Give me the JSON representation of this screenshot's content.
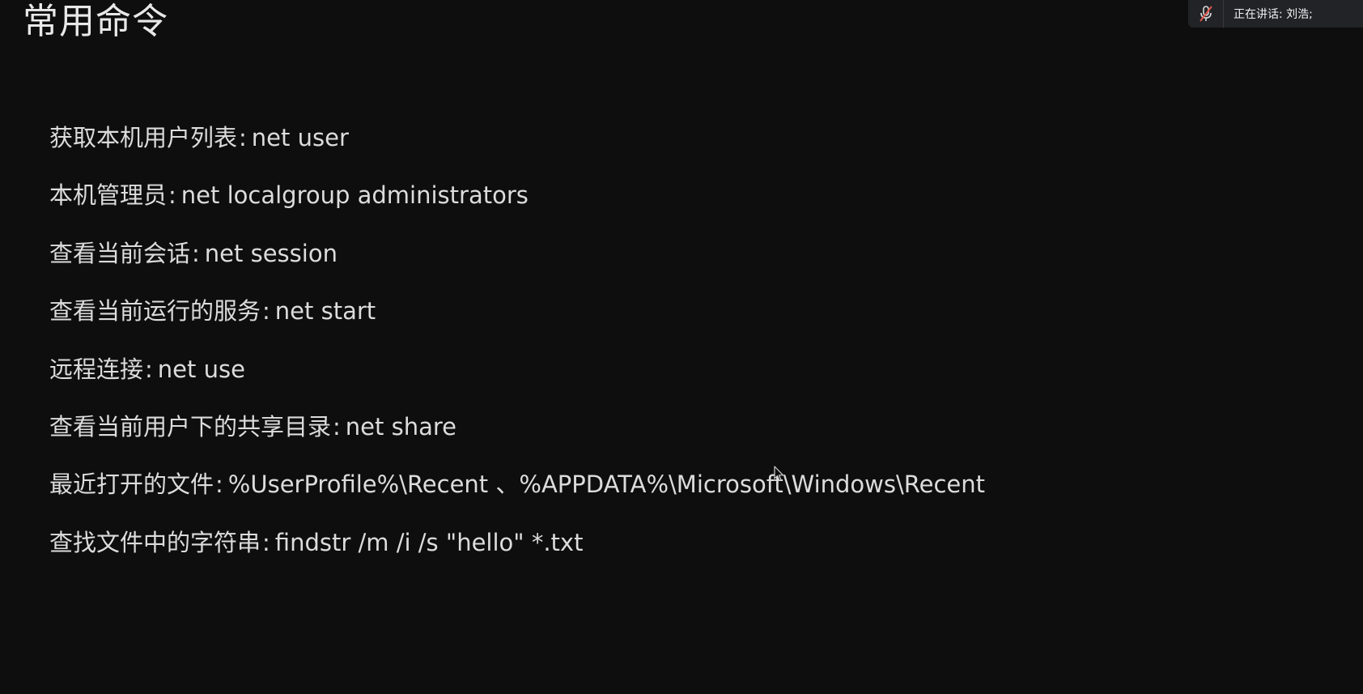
{
  "slide": {
    "title": "常用命令"
  },
  "commands": [
    {
      "label": "获取本机用户列表",
      "command": "net user"
    },
    {
      "label": "本机管理员",
      "command": "net localgroup administrators"
    },
    {
      "label": "查看当前会话",
      "command": "net session"
    },
    {
      "label": "查看当前运行的服务",
      "command": "net start"
    },
    {
      "label": "远程连接",
      "command": "net use"
    },
    {
      "label": "查看当前用户下的共享目录",
      "command": "net share"
    },
    {
      "label": "最近打开的文件",
      "command": "%UserProfile%\\Recent 、%APPDATA%\\Microsoft\\Windows\\Recent"
    },
    {
      "label": "查找文件中的字符串",
      "command": "findstr /m /i /s \"hello\" *.txt"
    }
  ],
  "separator": ":",
  "speaker_panel": {
    "text": "正在讲话: 刘浩;",
    "mic_icon": "mic-muted-icon"
  },
  "colors": {
    "background": "#0e0e0e",
    "text": "#dcdcdc",
    "panel": "#222326",
    "mic_muted": "#e0554a"
  }
}
